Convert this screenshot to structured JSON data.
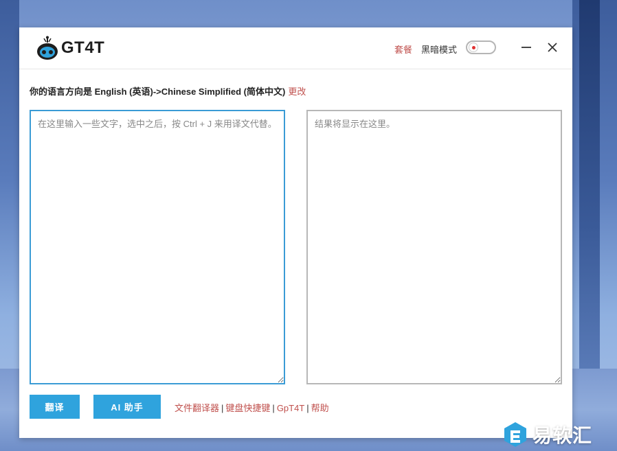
{
  "app": {
    "logo_text": "GT4T"
  },
  "header": {
    "plan_link": "套餐",
    "dark_mode_label": "黑暗模式",
    "dark_mode_on": false
  },
  "language": {
    "direction_text": "你的语言方向是 English (英语)->Chinese Simplified (简体中文)",
    "change_link": "更改"
  },
  "source": {
    "placeholder": "在这里输入一些文字，选中之后，按 Ctrl + J 来用译文代替。",
    "value": ""
  },
  "result": {
    "placeholder": "结果将显示在这里。",
    "value": ""
  },
  "actions": {
    "translate_label": "翻译",
    "ai_label": "AI 助手"
  },
  "links": [
    {
      "label": "文件翻译器"
    },
    {
      "label": "键盘快捷键"
    },
    {
      "label": "GpT4T"
    },
    {
      "label": "帮助"
    }
  ],
  "watermark": {
    "text": "易软汇"
  },
  "colors": {
    "accent": "#2fa3dd",
    "link": "#c0504d",
    "toggle_dot": "#e03131"
  }
}
